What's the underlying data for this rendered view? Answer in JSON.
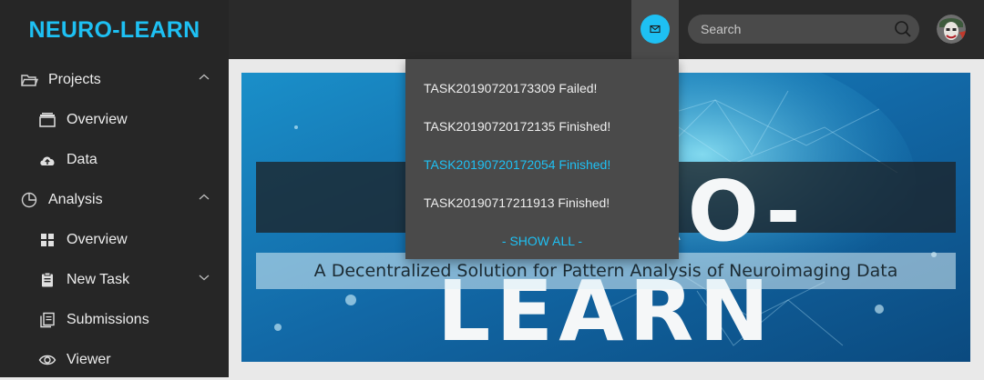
{
  "brand": {
    "name": "NEURO-LEARN",
    "color": "#1ec0f3"
  },
  "sidebar": {
    "groups": [
      {
        "label": "Projects",
        "icon": "folder-open-icon",
        "expanded": true,
        "items": [
          {
            "label": "Overview",
            "icon": "archive-icon"
          },
          {
            "label": "Data",
            "icon": "cloud-upload-icon"
          }
        ]
      },
      {
        "label": "Analysis",
        "icon": "pie-chart-icon",
        "expanded": true,
        "items": [
          {
            "label": "Overview",
            "icon": "grid-icon"
          },
          {
            "label": "New Task",
            "icon": "clipboard-icon",
            "has_submenu": true
          },
          {
            "label": "Submissions",
            "icon": "documents-icon"
          },
          {
            "label": "Viewer",
            "icon": "eye-icon"
          }
        ]
      }
    ]
  },
  "header": {
    "mail_icon": "mail-icon",
    "search": {
      "placeholder": "Search",
      "value": ""
    },
    "avatar_icon": "user-avatar"
  },
  "notifications": {
    "items": [
      {
        "text": "TASK20190720173309 Failed!",
        "active": false
      },
      {
        "text": "TASK20190720172135 Finished!",
        "active": false
      },
      {
        "text": "TASK20190720172054 Finished!",
        "active": true
      },
      {
        "text": "TASK20190717211913 Finished!",
        "active": false
      }
    ],
    "show_all": "- SHOW ALL -"
  },
  "banner": {
    "title": "NEURO-LEARN",
    "subtitle": "A Decentralized Solution for Pattern Analysis of Neuroimaging Data"
  },
  "colors": {
    "accent": "#1ec0f3",
    "sidebar_bg": "#262626",
    "topbar_bg": "#2a2a2a",
    "dropdown_bg": "#4a4a4a"
  }
}
